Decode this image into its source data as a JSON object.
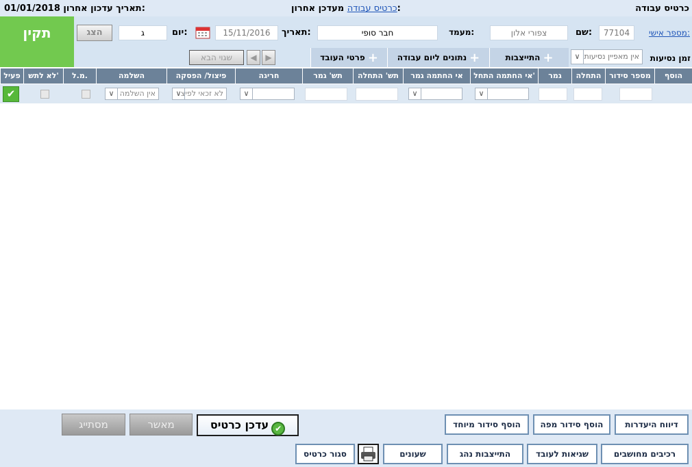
{
  "top": {
    "title": "כרטיס עבודה",
    "last_updater_label": "מעדכן אחרון:",
    "last_updater_link": "כרטיס עבודה",
    "last_update_label": "תאריך עדכון אחרון:",
    "last_update_value": "01/01/2018"
  },
  "header": {
    "employee_id_label": "מספר אישי:",
    "employee_id": "77104",
    "name_label": "שם:",
    "name": "צפורי אלון",
    "status_label": "מעמד:",
    "status": "חבר סופי",
    "date_label": "תאריך:",
    "date": "15/11/2016",
    "day_label": "יום:",
    "day": "ג",
    "show_button": "הצג",
    "next_error_button": "שגוי הבא",
    "valid_status": "תקין",
    "travel_time_label": "זמן נסיעות",
    "travel_time_value": "אין מאפיין נסיעות"
  },
  "tabs": {
    "attendance": "התייצבות",
    "workday_data": "נתונים ליום עבודה",
    "employee_details": "פרטי העובד"
  },
  "table": {
    "headers": {
      "add": "הוסף",
      "order_no": "מספר סידור",
      "start": "התחלה",
      "end": "גמר",
      "no_sign_start": "אי החתמה התחל'",
      "no_sign_end": "אי החתמה גמר",
      "ts_start": "תש' התחלה",
      "ts_end": "תש' גמר",
      "exception": "חריגה",
      "split_break": "פיצול/ הפסקה",
      "completion": "השלמה",
      "ml": "מ.ל.",
      "no_pay": "לא לתש'",
      "active": "פעיל"
    },
    "row": {
      "split_break": "לא זכאי לפיצ",
      "completion": "אין השלמה"
    }
  },
  "bottom": {
    "update_card": "עדכן כרטיס",
    "approver": "מאשר",
    "finalizer": "מסתייג",
    "absence_report": "דיווח היעדרות",
    "add_map_order": "הוסף סידור מפה",
    "add_special_order": "הוסף סידור מיוחד",
    "calculated_components": "רכיבים מחושבים",
    "employee_errors": "שגיאות לעובד",
    "driver_attendance": "התייצבות נהג",
    "clocks": "שעונים",
    "close_card": "סגור כרטיס"
  }
}
